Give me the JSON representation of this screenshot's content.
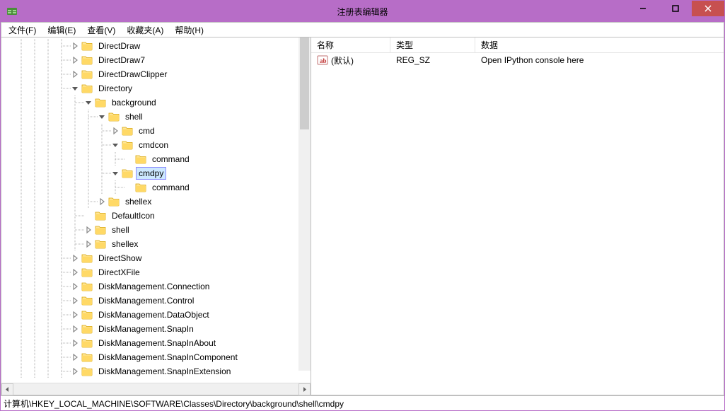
{
  "window": {
    "title": "注册表编辑器"
  },
  "menu": {
    "file": "文件(F)",
    "edit": "编辑(E)",
    "view": "查看(V)",
    "favorites": "收藏夹(A)",
    "help": "帮助(H)"
  },
  "tree": [
    {
      "indent": 5,
      "toggle": "closed",
      "label": "DirectDraw"
    },
    {
      "indent": 5,
      "toggle": "closed",
      "label": "DirectDraw7"
    },
    {
      "indent": 5,
      "toggle": "closed",
      "label": "DirectDrawClipper"
    },
    {
      "indent": 5,
      "toggle": "open",
      "label": "Directory"
    },
    {
      "indent": 6,
      "toggle": "open",
      "label": "background"
    },
    {
      "indent": 7,
      "toggle": "open",
      "label": "shell"
    },
    {
      "indent": 8,
      "toggle": "closed",
      "label": "cmd"
    },
    {
      "indent": 8,
      "toggle": "open",
      "label": "cmdcon"
    },
    {
      "indent": 9,
      "toggle": "none",
      "label": "command"
    },
    {
      "indent": 8,
      "toggle": "open",
      "label": "cmdpy",
      "selected": true
    },
    {
      "indent": 9,
      "toggle": "none",
      "label": "command"
    },
    {
      "indent": 7,
      "toggle": "closed",
      "label": "shellex"
    },
    {
      "indent": 6,
      "toggle": "none",
      "label": "DefaultIcon"
    },
    {
      "indent": 6,
      "toggle": "closed",
      "label": "shell"
    },
    {
      "indent": 6,
      "toggle": "closed",
      "label": "shellex"
    },
    {
      "indent": 5,
      "toggle": "closed",
      "label": "DirectShow"
    },
    {
      "indent": 5,
      "toggle": "closed",
      "label": "DirectXFile"
    },
    {
      "indent": 5,
      "toggle": "closed",
      "label": "DiskManagement.Connection"
    },
    {
      "indent": 5,
      "toggle": "closed",
      "label": "DiskManagement.Control"
    },
    {
      "indent": 5,
      "toggle": "closed",
      "label": "DiskManagement.DataObject"
    },
    {
      "indent": 5,
      "toggle": "closed",
      "label": "DiskManagement.SnapIn"
    },
    {
      "indent": 5,
      "toggle": "closed",
      "label": "DiskManagement.SnapInAbout"
    },
    {
      "indent": 5,
      "toggle": "closed",
      "label": "DiskManagement.SnapInComponent"
    },
    {
      "indent": 5,
      "toggle": "closed",
      "label": "DiskManagement.SnapInExtension"
    }
  ],
  "list": {
    "headers": {
      "name": "名称",
      "type": "类型",
      "data": "数据"
    },
    "col_widths": {
      "name": 112,
      "type": 120,
      "data": 320
    },
    "rows": [
      {
        "name": "(默认)",
        "type": "REG_SZ",
        "data": "Open IPython console here"
      }
    ]
  },
  "statusbar": {
    "path": "计算机\\HKEY_LOCAL_MACHINE\\SOFTWARE\\Classes\\Directory\\background\\shell\\cmdpy"
  },
  "colors": {
    "titlebar": "#b76dc7",
    "close": "#c75050"
  }
}
